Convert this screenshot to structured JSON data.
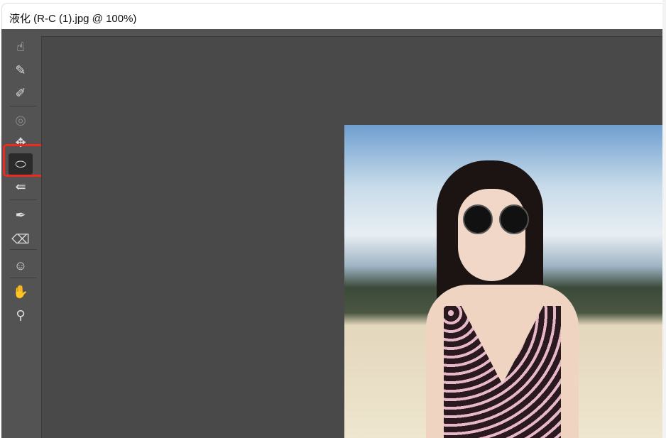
{
  "window": {
    "title": "液化 (R-C (1).jpg @ 100%)"
  },
  "toolbar": {
    "tools": [
      {
        "name": "forward-warp-tool",
        "glyph": "☝"
      },
      {
        "name": "reconstruct-tool",
        "glyph": "✎"
      },
      {
        "name": "smooth-tool",
        "glyph": "✐"
      },
      {
        "name": "twirl-tool",
        "glyph": "◎"
      },
      {
        "name": "pucker-tool",
        "glyph": "✥"
      },
      {
        "name": "bloat-tool",
        "glyph": "⬭"
      },
      {
        "name": "push-left-tool",
        "glyph": "⇚"
      },
      {
        "name": "freeze-mask-tool",
        "glyph": "✒"
      },
      {
        "name": "thaw-mask-tool",
        "glyph": "⌫"
      },
      {
        "name": "face-tool",
        "glyph": "☺"
      },
      {
        "name": "hand-tool",
        "glyph": "✋"
      },
      {
        "name": "zoom-tool",
        "glyph": "⚲"
      }
    ],
    "active": 5
  },
  "colors": {
    "highlight": "#f0281e",
    "panel": "#535353",
    "canvas": "#494949"
  }
}
